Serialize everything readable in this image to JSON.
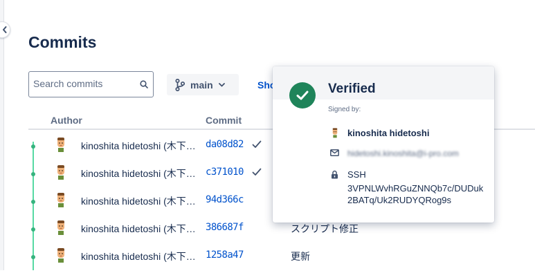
{
  "page": {
    "title": "Commits"
  },
  "search": {
    "placeholder": "Search commits"
  },
  "branch": {
    "label": "main"
  },
  "toolbar": {
    "show_label": "Sho"
  },
  "table": {
    "headers": {
      "author": "Author",
      "commit": "Commit"
    },
    "rows": [
      {
        "author": "kinoshita hidetoshi (木下…",
        "hash": "da08d82",
        "verified": true,
        "message": ""
      },
      {
        "author": "kinoshita hidetoshi (木下…",
        "hash": "c371010",
        "verified": true,
        "message": ""
      },
      {
        "author": "kinoshita hidetoshi (木下…",
        "hash": "94d366c",
        "verified": false,
        "message": ""
      },
      {
        "author": "kinoshita hidetoshi (木下…",
        "hash": "386687f",
        "verified": false,
        "message": "スクリプト修正"
      },
      {
        "author": "kinoshita hidetoshi (木下…",
        "hash": "1258a47",
        "verified": false,
        "message": "更新"
      }
    ]
  },
  "popover": {
    "title": "Verified",
    "signed_by_label": "Signed by:",
    "signer_name": "kinoshita hidetoshi",
    "signer_email": "hidetoshi.kinoshita@i-pro.com",
    "key_type": "SSH",
    "key_fingerprint": "3VPNLWvhRGuZNNQb7c/DUDuk2BATq/Uk2RUDYQRog9s"
  },
  "colors": {
    "accent": "#0052cc",
    "verified": "#1f845a",
    "graph": "#36b37e"
  },
  "icons": {
    "collapse": "chevron-left-icon",
    "search": "search-icon",
    "branch": "git-branch-icon",
    "dropdown": "chevron-down-icon",
    "verified_row": "check-icon",
    "verified_badge": "check-circle-icon",
    "email": "mail-icon",
    "key": "lock-icon"
  }
}
